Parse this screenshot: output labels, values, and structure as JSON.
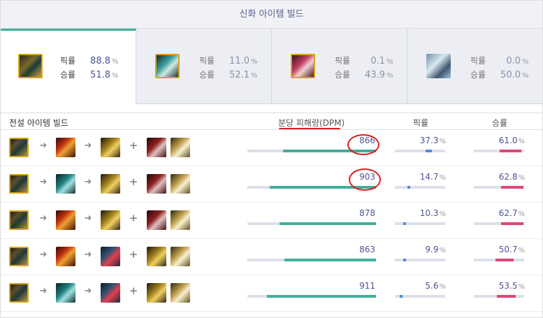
{
  "mythic": {
    "title": "신화 아이템 빌드",
    "pick_label": "픽률",
    "win_label": "승률",
    "pct_sign": "%",
    "items": [
      {
        "icon": "mythic-item-a",
        "pick": "88.8",
        "win": "51.8"
      },
      {
        "icon": "mythic-item-b",
        "pick": "11.0",
        "win": "52.1"
      },
      {
        "icon": "mythic-item-c",
        "pick": "0.1",
        "win": "43.9"
      },
      {
        "icon": "mythic-item-d",
        "pick": "0.0",
        "win": "50.0"
      }
    ]
  },
  "legendary": {
    "title": "전설 아이템 빌드",
    "col_dpm": "분당 피해량(DPM)",
    "col_pick": "픽률",
    "col_win": "승률",
    "pct_sign": "%",
    "rows": [
      {
        "dpm": "866",
        "dpm_ratio": 0.85,
        "pick": "37.3",
        "pick_ratio": 0.37,
        "win": "61.0",
        "win_ratio": 0.61
      },
      {
        "dpm": "903",
        "dpm_ratio": 0.97,
        "pick": "14.7",
        "pick_ratio": 0.15,
        "win": "62.8",
        "win_ratio": 0.63
      },
      {
        "dpm": "878",
        "dpm_ratio": 0.88,
        "pick": "10.3",
        "pick_ratio": 0.1,
        "win": "62.7",
        "win_ratio": 0.63
      },
      {
        "dpm": "863",
        "dpm_ratio": 0.84,
        "pick": "9.9",
        "pick_ratio": 0.1,
        "win": "50.7",
        "win_ratio": 0.51
      },
      {
        "dpm": "911",
        "dpm_ratio": 1.0,
        "pick": "5.6",
        "pick_ratio": 0.06,
        "win": "53.5",
        "win_ratio": 0.54
      }
    ]
  },
  "colors": {
    "accent_teal": "#3faf9a",
    "pick_bar": "#4f8be0",
    "win_bar": "#e0457b",
    "value_text": "#4e5391",
    "annotation_red": "#d62020"
  }
}
